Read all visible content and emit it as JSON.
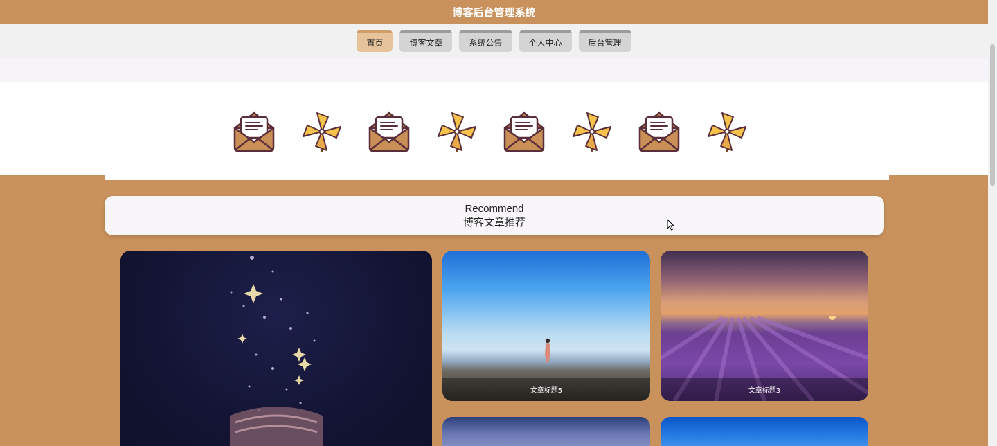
{
  "header": {
    "title": "博客后台管理系统"
  },
  "nav": [
    {
      "label": "首页",
      "active": true
    },
    {
      "label": "博客文章",
      "active": false
    },
    {
      "label": "系统公告",
      "active": false
    },
    {
      "label": "个人中心",
      "active": false
    },
    {
      "label": "后台管理",
      "active": false
    }
  ],
  "icons": [
    "envelope-icon",
    "pinwheel-icon",
    "envelope-icon",
    "pinwheel-icon",
    "envelope-icon",
    "pinwheel-icon",
    "envelope-icon",
    "pinwheel-icon"
  ],
  "recommend": {
    "en": "Recommend",
    "zh": "博客文章推荐"
  },
  "articles": [
    {
      "title": ""
    },
    {
      "title": "文章标题5"
    },
    {
      "title": "文章标题3"
    },
    {
      "title": ""
    },
    {
      "title": ""
    }
  ],
  "colors": {
    "brand": "#c9925c",
    "nav_active": "#e6c39a",
    "nav_inactive": "#d4d4d4"
  }
}
